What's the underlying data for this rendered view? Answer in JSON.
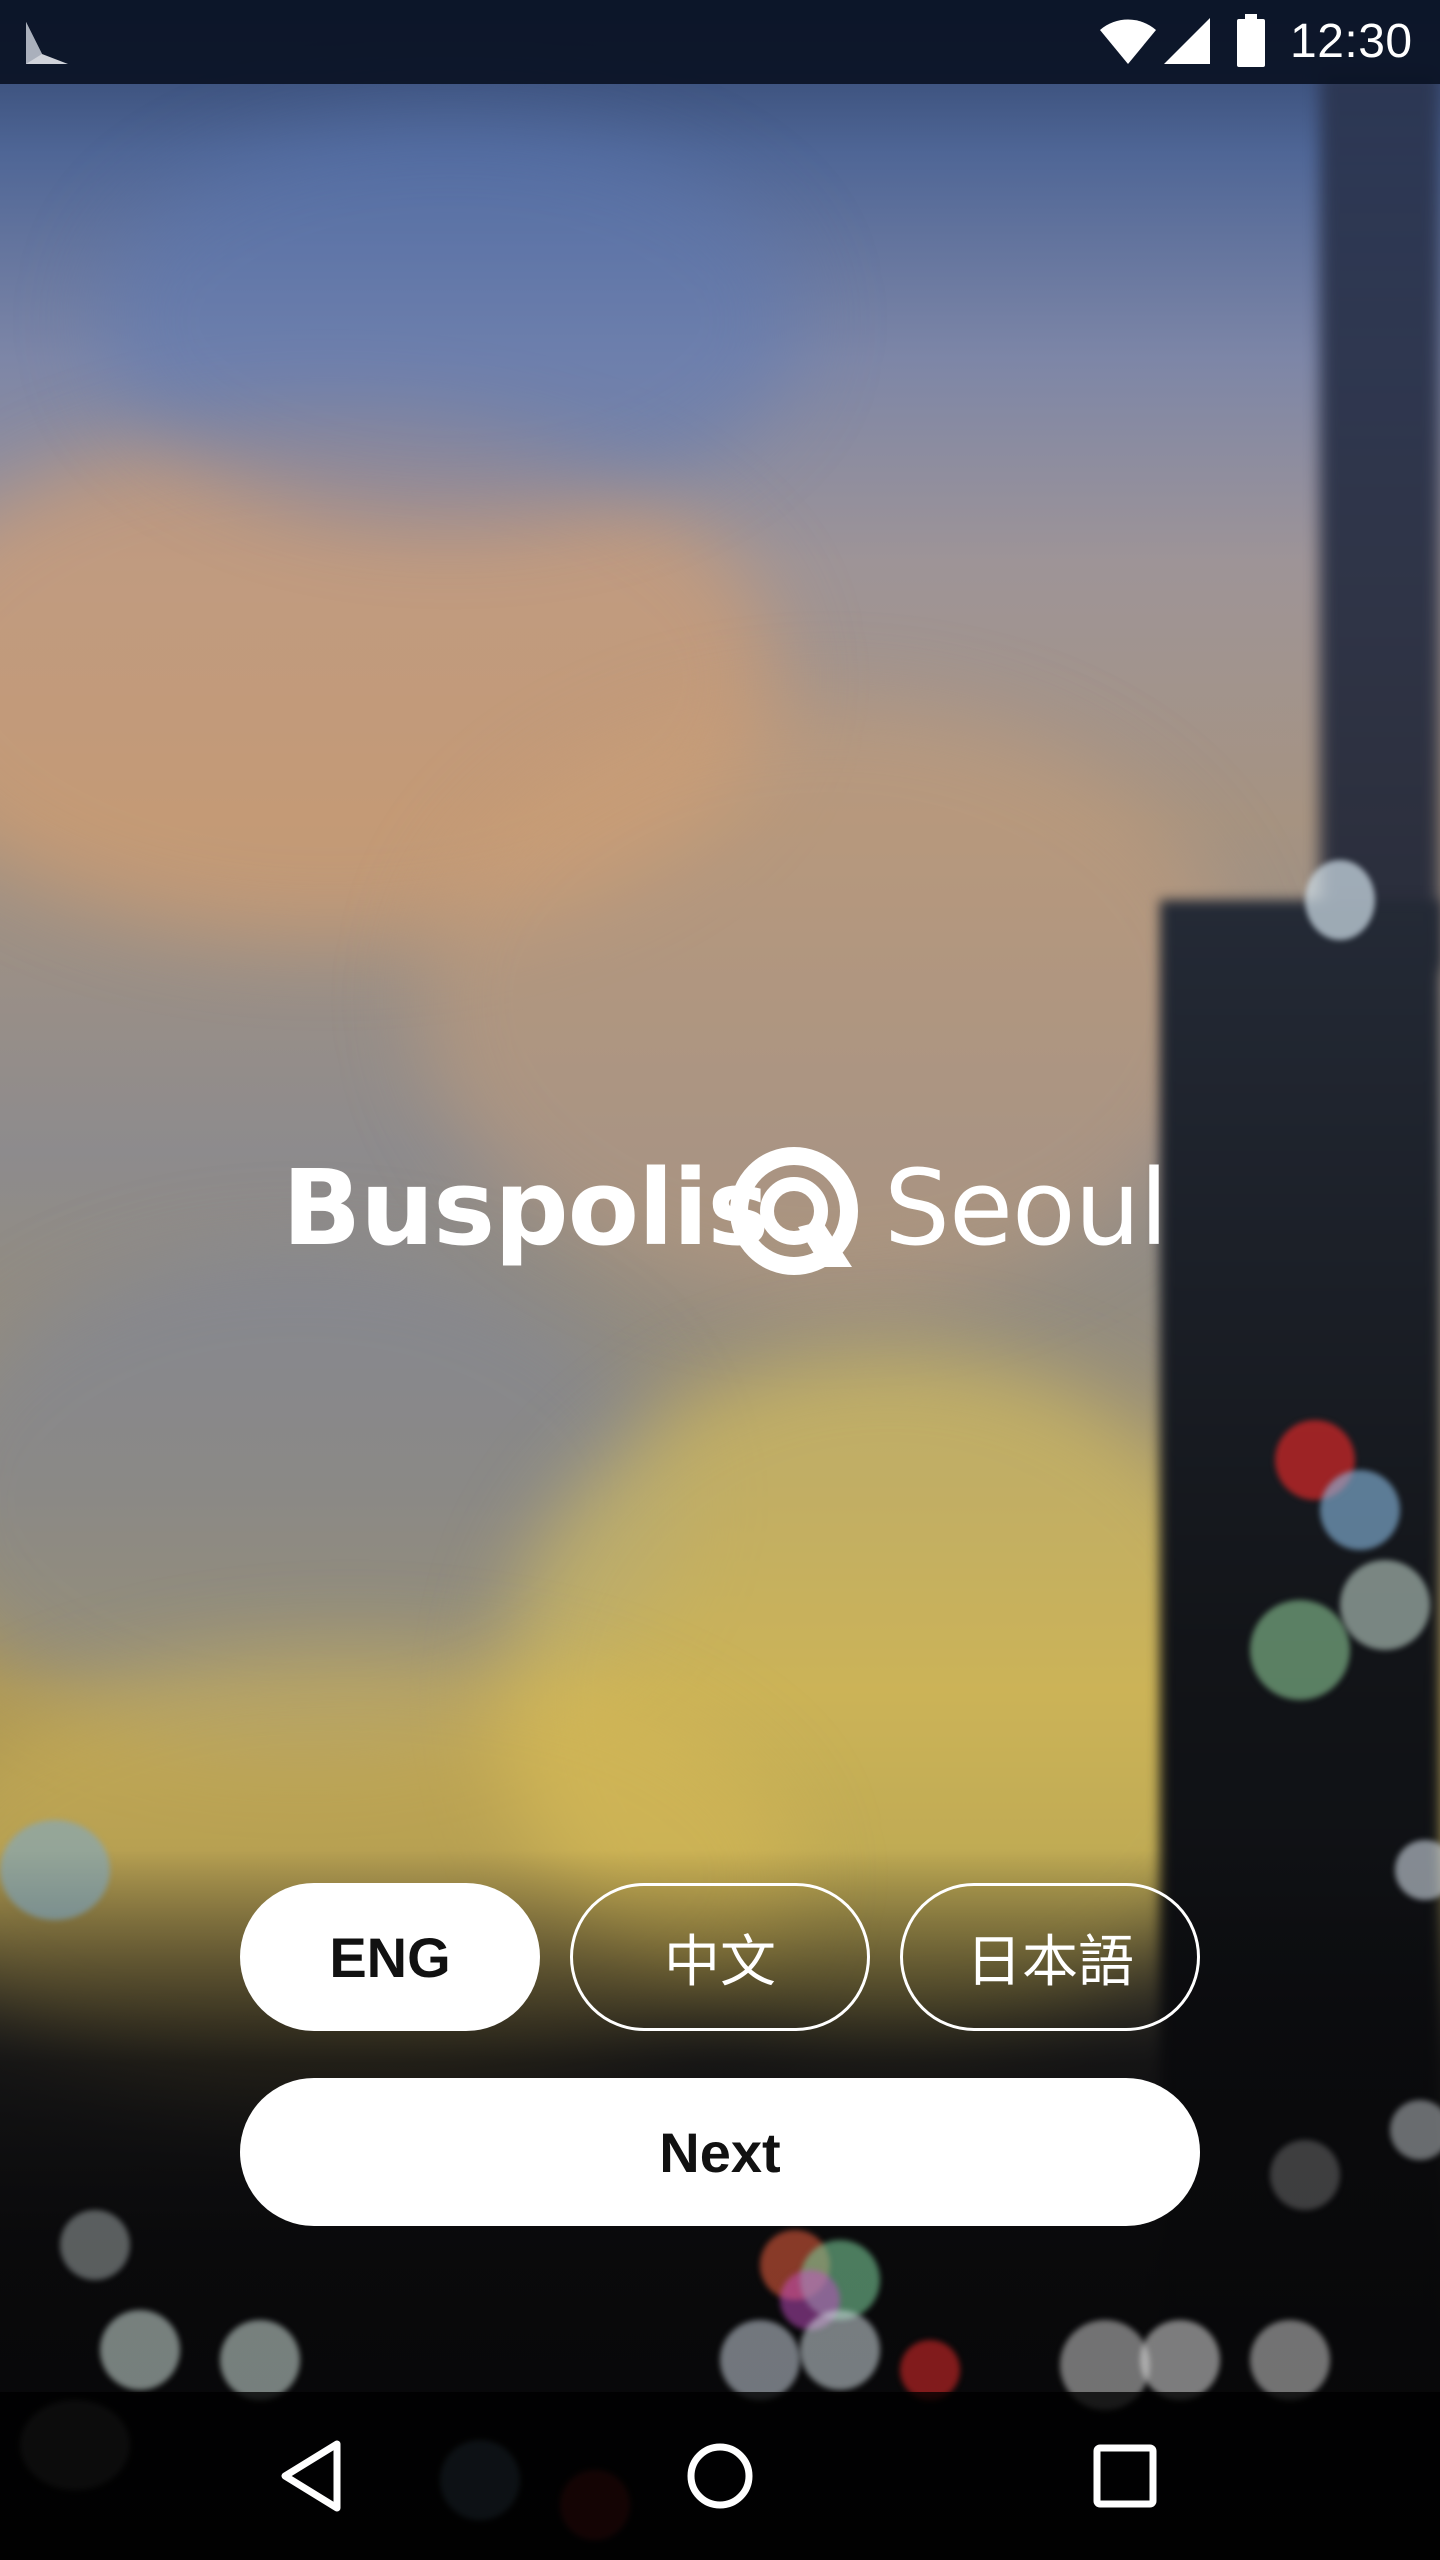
{
  "status_bar": {
    "time": "12:30",
    "icons": [
      "play-store-notification-icon",
      "wifi-icon",
      "cell-signal-icon",
      "battery-icon"
    ]
  },
  "logo": {
    "brand_left": "Buspolis",
    "brand_right": "Seoul",
    "mark_icon": "q-logo-mark-icon"
  },
  "languages": {
    "selected": "ENG",
    "options": [
      {
        "label": "ENG",
        "selected": true
      },
      {
        "label": "中文",
        "selected": false
      },
      {
        "label": "日本語",
        "selected": false
      }
    ]
  },
  "actions": {
    "next_label": "Next"
  },
  "nav_bar": {
    "icons": [
      "back-icon",
      "home-icon",
      "recents-icon"
    ]
  },
  "colors": {
    "button_fill": "#ffffff",
    "button_text": "#111111",
    "outline": "#ffffff"
  }
}
